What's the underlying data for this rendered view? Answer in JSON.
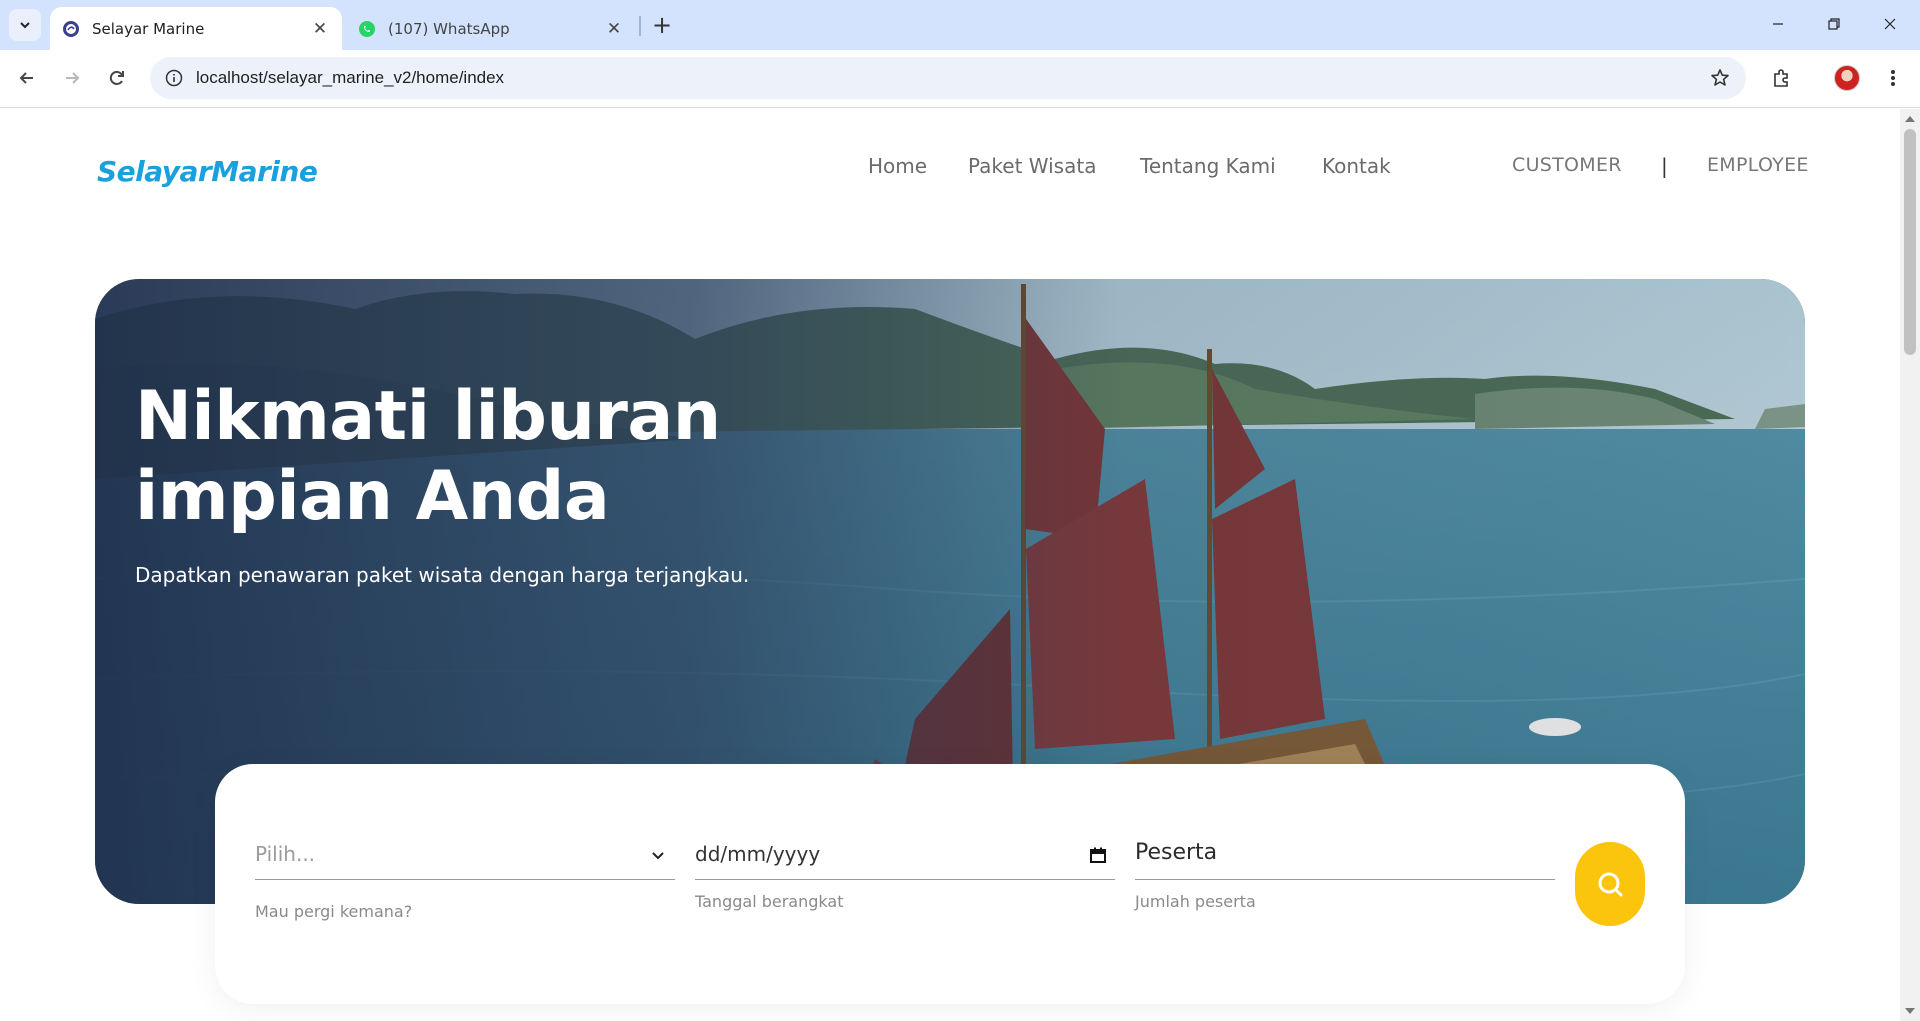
{
  "browser": {
    "tabs": [
      {
        "title": "Selayar Marine",
        "active": true
      },
      {
        "title": "(107) WhatsApp",
        "active": false
      }
    ],
    "url": "localhost/selayar_marine_v2/home/index"
  },
  "site": {
    "brand": "SelayarMarine",
    "nav": {
      "home": "Home",
      "paket": "Paket Wisata",
      "tentang": "Tentang Kami",
      "kontak": "Kontak"
    },
    "auth": {
      "customer": "CUSTOMER",
      "separator": "|",
      "employee": "EMPLOYEE"
    },
    "hero": {
      "title_line1": "Nikmati liburan",
      "title_line2": "impian Anda",
      "subtitle": "Dapatkan penawaran paket wisata dengan harga terjangkau."
    },
    "search": {
      "destination_value": "Pilih...",
      "destination_hint": "Mau pergi kemana?",
      "date_value": "dd/mm/yyyy",
      "date_hint": "Tanggal berangkat",
      "participants_value": "Peserta",
      "participants_hint": "Jumlah peserta"
    }
  },
  "colors": {
    "brand": "#1aa0dd",
    "search_button": "#fbc40d",
    "tabbar": "#d3e3fd"
  },
  "icons": [
    "chevron-down-icon",
    "close-icon",
    "plus-icon",
    "minimize-icon",
    "restore-icon",
    "back-icon",
    "forward-icon",
    "reload-icon",
    "info-icon",
    "star-icon",
    "extensions-icon",
    "more-vert-icon",
    "calendar-icon",
    "search-icon"
  ]
}
